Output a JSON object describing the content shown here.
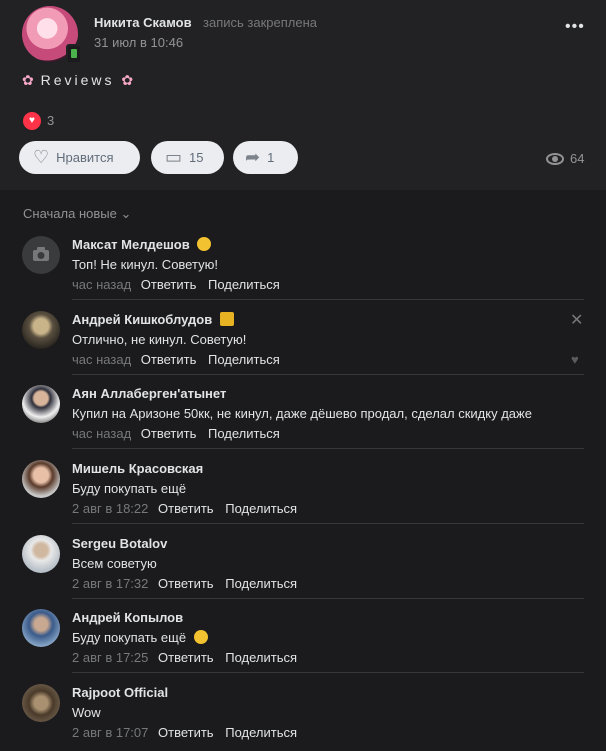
{
  "post": {
    "author": "Никита Скамов",
    "pinned": "запись закреплена",
    "date": "31 июл в 10:46",
    "text": "Reviews",
    "reactions_count": "3",
    "like_label": "Нравится",
    "comments_count": "15",
    "shares_count": "1",
    "views_count": "64"
  },
  "sort_label": "Сначала новые",
  "actions": {
    "reply": "Ответить",
    "share": "Поделиться"
  },
  "comments": [
    {
      "name": "Максат Мелдешов",
      "text": "Топ! Не кинул. Советую!",
      "time": "час назад"
    },
    {
      "name": "Андрей Кишкоблудов",
      "text": "Отлично, не кинул. Советую!",
      "time": "час назад"
    },
    {
      "name": "Аян Аллаберген'атынет",
      "text": "Купил на Аризоне 50кк, не кинул, даже дёшево продал, сделал скидку даже",
      "time": "час назад"
    },
    {
      "name": "Мишель Красовская",
      "text": "Буду покупать ещё",
      "time": "2 авг в 18:22"
    },
    {
      "name": "Sergeu Botalov",
      "text": "Всем советую",
      "time": "2 авг в 17:32"
    },
    {
      "name": "Андрей Копылов",
      "text": "Буду покупать ещё",
      "time": "2 авг в 17:25"
    },
    {
      "name": "Rajpoot Official",
      "text": "Wow",
      "time": "2 авг в 17:07"
    }
  ]
}
